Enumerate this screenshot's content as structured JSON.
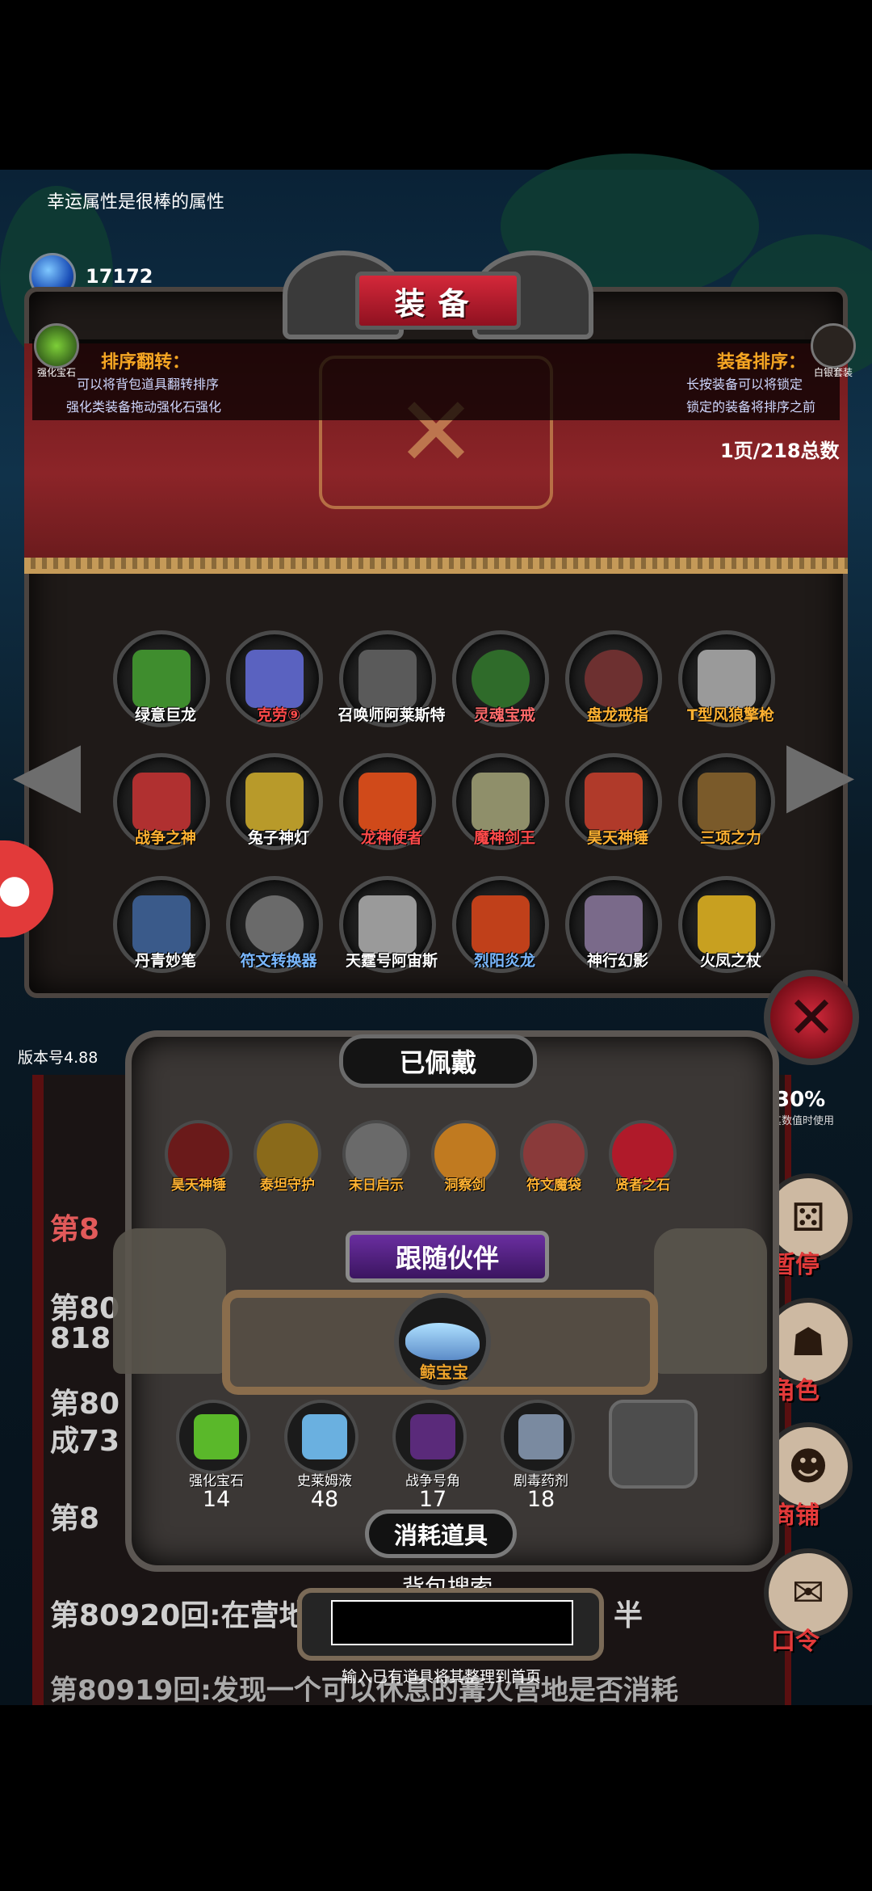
{
  "hint": "幸运属性是很棒的属性",
  "gems": {
    "label": "宝石",
    "count": "17172"
  },
  "left_side_icon": "强化宝石",
  "right_side_icon": "白银套装",
  "equipment_panel": {
    "title": "装备",
    "sort_flip": {
      "title": "排序翻转：",
      "line1": "可以将背包道具翻转排序",
      "line2": "强化类装备拖动强化石强化"
    },
    "sort_order": {
      "title": "装备排序：",
      "line1": "长按装备可以将锁定",
      "line2": "锁定的装备将排序之前"
    },
    "page_count": "1页/218总数",
    "items": [
      {
        "label": "绿意巨龙",
        "color": "#ffffff"
      },
      {
        "label": "克劳⑨",
        "color": "#ff4a4a"
      },
      {
        "label": "召唤师阿莱斯特",
        "color": "#ffffff"
      },
      {
        "label": "灵魂宝戒",
        "color": "#ff6b6b"
      },
      {
        "label": "盘龙戒指",
        "color": "#ffb232"
      },
      {
        "label": "T型风狼擎枪",
        "color": "#ffb232"
      },
      {
        "label": "战争之神",
        "color": "#ffb232"
      },
      {
        "label": "兔子神灯",
        "color": "#ffffff"
      },
      {
        "label": "龙神使者",
        "color": "#ff4a4a"
      },
      {
        "label": "魔神剑王",
        "color": "#ff4a4a"
      },
      {
        "label": "昊天神锤",
        "color": "#ffb232"
      },
      {
        "label": "三项之力",
        "color": "#ffb232"
      },
      {
        "label": "丹青妙笔",
        "color": "#ffffff"
      },
      {
        "label": "符文转换器",
        "color": "#7ab8ff"
      },
      {
        "label": "天霆号阿宙斯",
        "color": "#ffffff"
      },
      {
        "label": "烈阳炎龙",
        "color": "#7ab8ff"
      },
      {
        "label": "神行幻影",
        "color": "#ffffff"
      },
      {
        "label": "火凤之杖",
        "color": "#ffffff"
      }
    ]
  },
  "version": "版本号4.88",
  "logs": {
    "red_line": "第8",
    "lines": [
      "第80",
      "818",
      "第80",
      "成73",
      "第8",
      "第80920回:在营地",
      "第80919回:发现一个可以休息的篝火营地是否消耗"
    ],
    "half": "半"
  },
  "right_buttons": {
    "pct": "30%",
    "note": "其数值时使用",
    "pause": "暂停",
    "role": "角色",
    "shop": "商铺",
    "code": "口令"
  },
  "worn": {
    "title": "已佩戴",
    "items": [
      {
        "label": "昊天神锤"
      },
      {
        "label": "泰坦守护"
      },
      {
        "label": "末日启示"
      },
      {
        "label": "洞察剑"
      },
      {
        "label": "符文魔袋"
      },
      {
        "label": "贤者之石"
      }
    ]
  },
  "companion": {
    "title": "跟随伙伴",
    "name": "鲸宝宝"
  },
  "consumables": {
    "title": "消耗道具",
    "items": [
      {
        "label": "强化宝石",
        "count": "14"
      },
      {
        "label": "史莱姆液",
        "count": "48"
      },
      {
        "label": "战争号角",
        "count": "17"
      },
      {
        "label": "剧毒药剂",
        "count": "18"
      }
    ]
  },
  "search": {
    "title": "背包搜索",
    "placeholder": "",
    "hint": "输入已有道具将其整理到首页"
  }
}
